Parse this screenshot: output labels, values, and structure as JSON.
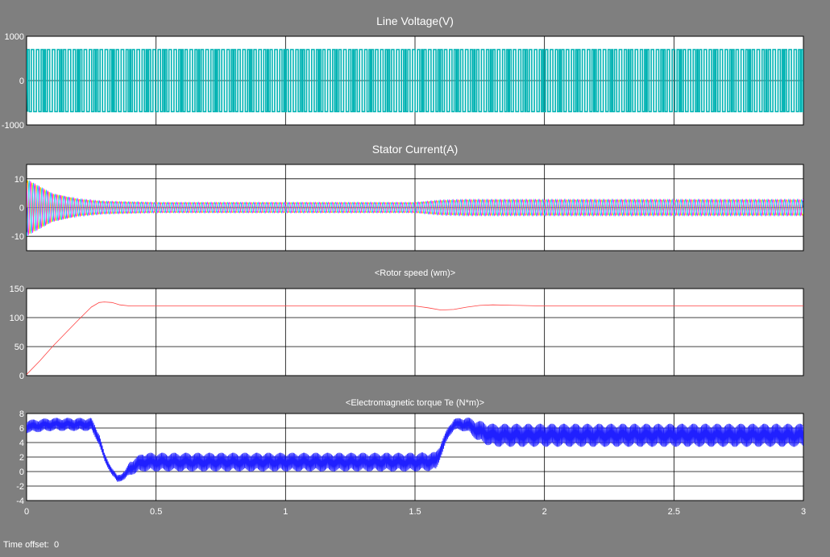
{
  "window": {
    "time_offset_label": "Time offset:",
    "time_offset_value": "0"
  },
  "colors": {
    "background": "#7f7f7f",
    "axes_background": "#ffffff",
    "grid": "#000000",
    "text": "#ffffff"
  },
  "chart_data": [
    {
      "type": "line",
      "title": "Line Voltage(V)",
      "xlim": [
        0,
        3
      ],
      "ylim": [
        -1000,
        1000
      ],
      "yticks": [
        -1000,
        0,
        1000
      ],
      "xticks": [
        0,
        0.5,
        1,
        1.5,
        2,
        2.5,
        3
      ],
      "xtick_labels": [],
      "grid": true,
      "series": [
        {
          "color": "#00b3b3",
          "kind": "pwm",
          "amplitude": 700
        }
      ]
    },
    {
      "type": "line",
      "title": "Stator Current(A)",
      "xlim": [
        0,
        3
      ],
      "ylim": [
        -15,
        15
      ],
      "yticks": [
        -10,
        0,
        10
      ],
      "xticks": [
        0,
        0.5,
        1,
        1.5,
        2,
        2.5,
        3
      ],
      "xtick_labels": [],
      "grid": true,
      "series": [
        {
          "color": "#ffd000",
          "kind": "three-phase",
          "phase": 0
        },
        {
          "color": "#ff00ff",
          "kind": "three-phase",
          "phase": 2.094
        },
        {
          "color": "#00c8ff",
          "kind": "three-phase",
          "phase": 4.189
        }
      ],
      "envelope": {
        "t": [
          0,
          0.1,
          0.2,
          0.3,
          0.5,
          1.0,
          1.5,
          1.6,
          1.7,
          2.0,
          3.0
        ],
        "amp": [
          10,
          5,
          3,
          2.2,
          1.8,
          1.8,
          1.8,
          2.6,
          2.8,
          2.8,
          2.8
        ]
      }
    },
    {
      "type": "line",
      "title": "<Rotor speed (wm)>",
      "xlim": [
        0,
        3
      ],
      "ylim": [
        0,
        150
      ],
      "yticks": [
        0,
        50,
        100,
        150
      ],
      "xticks": [
        0,
        0.5,
        1,
        1.5,
        2,
        2.5,
        3
      ],
      "xtick_labels": [],
      "grid": true,
      "series": [
        {
          "color": "#ff4040",
          "x": [
            0,
            0.05,
            0.1,
            0.15,
            0.2,
            0.25,
            0.28,
            0.3,
            0.33,
            0.36,
            0.4,
            0.5,
            1.0,
            1.5,
            1.55,
            1.6,
            1.65,
            1.7,
            1.75,
            1.8,
            1.9,
            2.0,
            2.5,
            3.0
          ],
          "y": [
            2,
            25,
            50,
            73,
            96,
            118,
            126,
            127,
            126,
            122,
            120,
            120,
            120,
            120,
            117,
            113,
            114,
            118,
            121,
            122,
            121,
            120,
            120,
            120
          ]
        }
      ]
    },
    {
      "type": "line",
      "title": "<Electromagnetic torque Te (N*m)>",
      "xlim": [
        0,
        3
      ],
      "ylim": [
        -4,
        8
      ],
      "yticks": [
        -4,
        -2,
        0,
        2,
        4,
        6,
        8
      ],
      "xticks": [
        0,
        0.5,
        1,
        1.5,
        2,
        2.5,
        3
      ],
      "xtick_labels": [
        "0",
        "0.5",
        "1",
        "1.5",
        "2",
        "2.5",
        "3"
      ],
      "grid": true,
      "series": [
        {
          "color": "#2020ff",
          "x": [
            0,
            0.1,
            0.25,
            0.28,
            0.3,
            0.33,
            0.35,
            0.38,
            0.4,
            0.45,
            0.5,
            1.0,
            1.5,
            1.58,
            1.6,
            1.63,
            1.65,
            1.7,
            1.75,
            1.8,
            2.0,
            2.5,
            3.0
          ],
          "y": [
            6.2,
            6.5,
            6.5,
            4.5,
            2.0,
            0.0,
            -1.0,
            -0.5,
            0.5,
            1.3,
            1.3,
            1.3,
            1.3,
            1.4,
            3.0,
            5.5,
            6.5,
            6.5,
            5.5,
            5.0,
            5.0,
            5.0,
            5.0
          ],
          "ripple": [
            0.9,
            0.9,
            0.9,
            0.8,
            0.6,
            0.5,
            0.5,
            0.6,
            1.0,
            1.3,
            1.3,
            1.3,
            1.3,
            1.3,
            1.0,
            0.8,
            0.8,
            1.0,
            1.5,
            1.6,
            1.6,
            1.6,
            1.6
          ]
        }
      ]
    }
  ]
}
